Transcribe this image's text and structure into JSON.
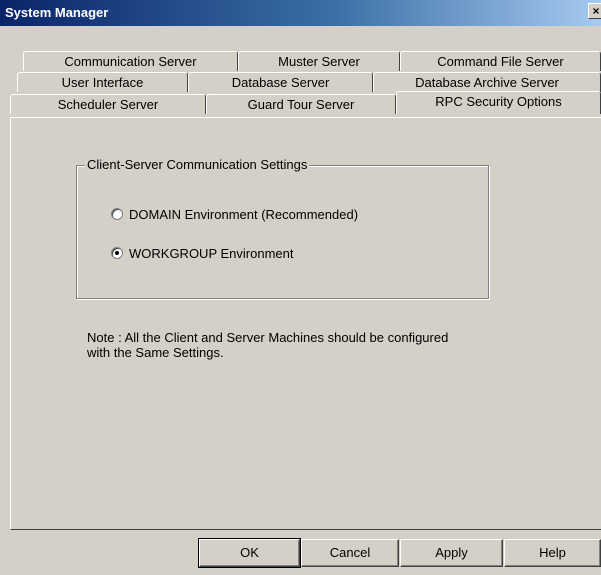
{
  "window": {
    "title": "System Manager",
    "close_glyph": "×"
  },
  "tabs": {
    "row1": [
      "Communication Server",
      "Muster Server",
      "Command File Server"
    ],
    "row2": [
      "User Interface",
      "Database Server",
      "Database Archive Server"
    ],
    "row3": [
      "Scheduler Server",
      "Guard Tour Server",
      "RPC Security Options"
    ],
    "active": "RPC Security Options"
  },
  "group": {
    "label": "Client-Server Communication Settings",
    "options": [
      {
        "label": "DOMAIN Environment (Recommended)",
        "selected": false
      },
      {
        "label": "WORKGROUP Environment",
        "selected": true
      }
    ]
  },
  "note": {
    "line1": "Note : All the Client and Server Machines should be configured",
    "line2": "with the Same Settings."
  },
  "buttons": {
    "ok": "OK",
    "cancel": "Cancel",
    "apply": "Apply",
    "help": "Help"
  }
}
